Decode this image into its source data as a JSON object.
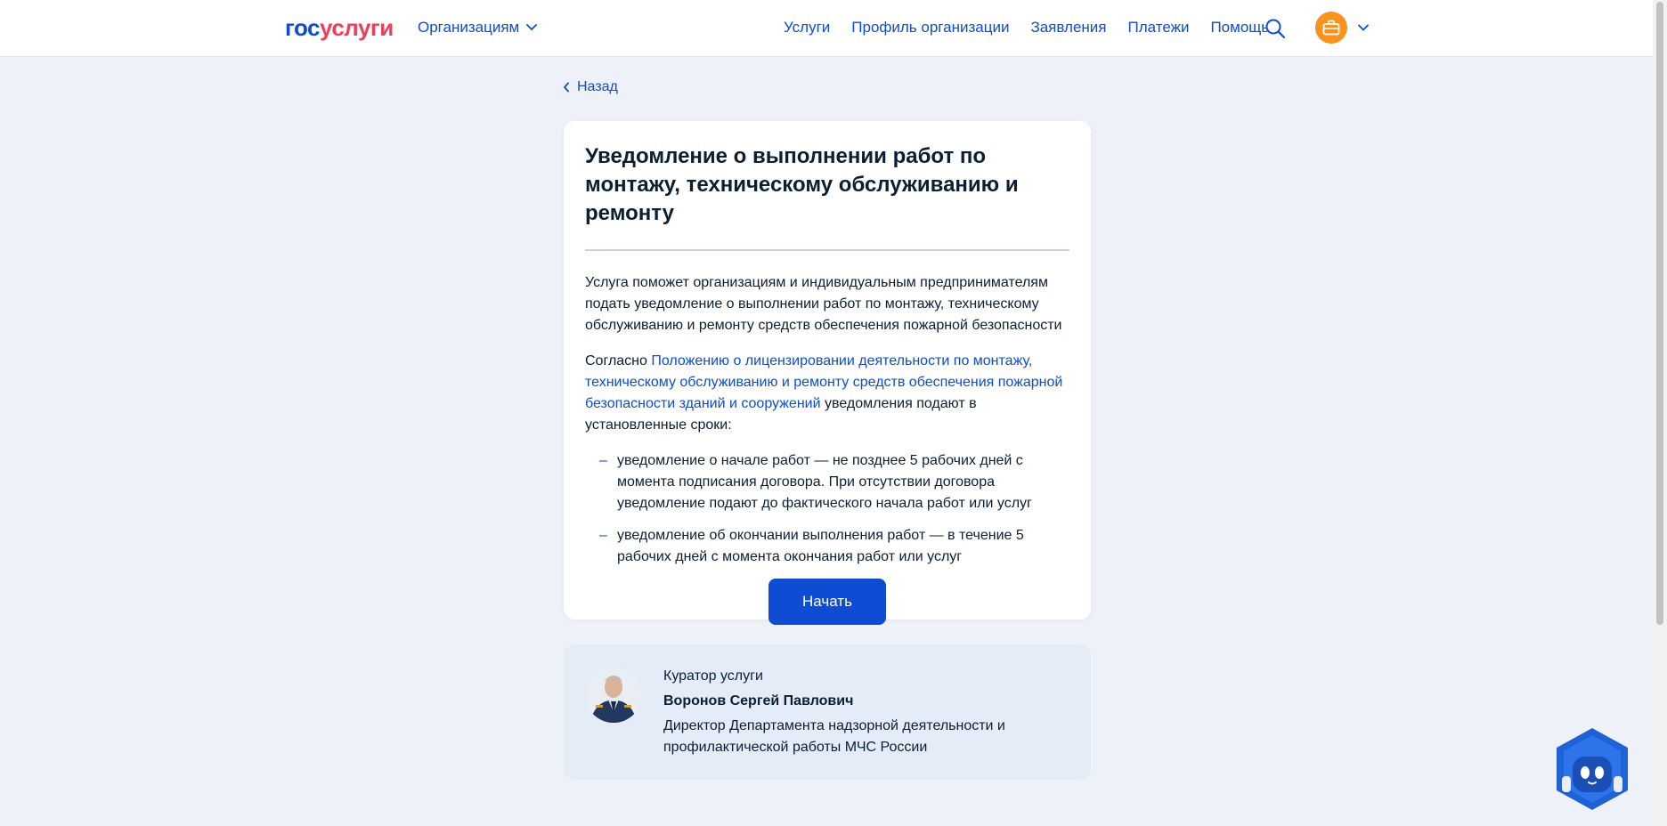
{
  "header": {
    "logo_gos": "гос",
    "logo_uslugi": "услуги",
    "org_menu": "Организациям",
    "nav": [
      "Услуги",
      "Профиль организации",
      "Заявления",
      "Платежи",
      "Помощь"
    ]
  },
  "back_label": "Назад",
  "card": {
    "title": "Уведомление о выполнении работ по монтажу, техническому обслуживанию и ремонту",
    "intro": "Услуга поможет организациям и индивидуальным предпринимателям подать уведомление о выполнении работ по монтажу, техническому обслуживанию и ремонту средств обеспечения пожарной безопасности",
    "according_prefix": "Согласно",
    "according_link": "Положению о лицензировании деятельности по монтажу, техническому обслуживанию и ремонту средств обеспечения пожарной безопасности зданий и сооружений",
    "according_suffix": "уведомления подают в установленные сроки:",
    "items": [
      "уведомление о начале работ — не позднее 5 рабочих дней с момента подписания договора. При отсутствии договора уведомление подают до фактического начала работ или услуг",
      "уведомление об окончании выполнения работ — в течение 5 рабочих дней с момента окончания работ или услуг"
    ],
    "start_button": "Начать"
  },
  "curator": {
    "label": "Куратор услуги",
    "name": "Воронов Сергей Павлович",
    "position": "Директор Департамента надзорной деятельности и профилактической работы МЧС России"
  },
  "colors": {
    "accent": "#0d4cd3",
    "brand_red": "#ee3f58",
    "background": "#eef2f8",
    "profile": "#f7931e"
  }
}
